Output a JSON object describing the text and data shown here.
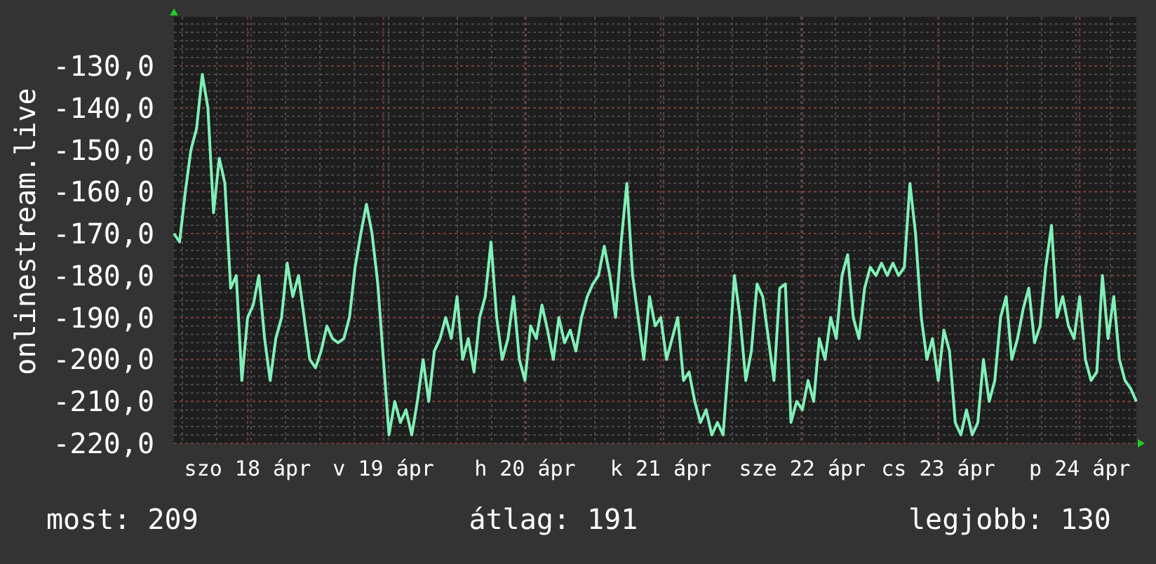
{
  "chart": {
    "chart_data": {
      "type": "line",
      "ylabel": "onlinestream.live",
      "ylim": [
        -220,
        -118.3
      ],
      "grid": true,
      "categories": [
        null,
        null,
        null,
        null,
        null,
        null,
        null,
        null,
        null,
        null,
        null,
        null,
        null,
        "szo 18 ápr",
        null,
        null,
        null,
        null,
        null,
        null,
        null,
        null,
        null,
        null,
        null,
        null,
        null,
        null,
        null,
        null,
        null,
        null,
        null,
        null,
        null,
        null,
        null,
        "v 19 ápr",
        null,
        null,
        null,
        null,
        null,
        null,
        null,
        null,
        null,
        null,
        null,
        null,
        null,
        null,
        null,
        null,
        null,
        null,
        null,
        null,
        null,
        null,
        null,
        null,
        "h 20 ápr",
        null,
        null,
        null,
        null,
        null,
        null,
        null,
        null,
        null,
        null,
        null,
        null,
        null,
        null,
        null,
        null,
        null,
        null,
        null,
        null,
        null,
        null,
        null,
        "k 21 ápr",
        null,
        null,
        null,
        null,
        null,
        null,
        null,
        null,
        null,
        null,
        null,
        null,
        null,
        null,
        null,
        null,
        null,
        null,
        null,
        null,
        null,
        null,
        null,
        null,
        "sze 22 ápr",
        null,
        null,
        null,
        null,
        null,
        null,
        null,
        null,
        null,
        null,
        null,
        null,
        null,
        null,
        null,
        null,
        null,
        null,
        null,
        null,
        null,
        null,
        null,
        "cs 23 ápr",
        null,
        null,
        null,
        null,
        null,
        null,
        null,
        null,
        null,
        null,
        null,
        null,
        null,
        null,
        null,
        null,
        null,
        null,
        null,
        null,
        null,
        null,
        null,
        null,
        "p 24 ápr",
        null,
        null,
        null,
        null,
        null,
        null,
        null,
        null,
        null,
        null
      ],
      "yticks": [
        {
          "value": -220,
          "label": "-220,0"
        },
        {
          "value": -210,
          "label": "-210,0"
        },
        {
          "value": -200,
          "label": "-200,0"
        },
        {
          "value": -190,
          "label": "-190,0"
        },
        {
          "value": -180,
          "label": "-180,0"
        },
        {
          "value": -170,
          "label": "-170,0"
        },
        {
          "value": -160,
          "label": "-160,0"
        },
        {
          "value": -150,
          "label": "-150,0"
        },
        {
          "value": -140,
          "label": "-140,0"
        },
        {
          "value": -130,
          "label": "-130,0"
        }
      ],
      "series": [
        {
          "color": "#80f0b8",
          "values": [
            -170,
            -172,
            -160,
            -150,
            -145,
            -132,
            -140,
            -165,
            -152,
            -158,
            -183,
            -180,
            -205,
            -190,
            -187,
            -180,
            -195,
            -205,
            -195,
            -190,
            -177,
            -185,
            -180,
            -190,
            -200,
            -202,
            -198,
            -192,
            -195,
            -196,
            -195,
            -190,
            -178,
            -170,
            -163,
            -170,
            -182,
            -200,
            -218,
            -210,
            -215,
            -212,
            -218,
            -210,
            -200,
            -210,
            -198,
            -195,
            -190,
            -195,
            -185,
            -200,
            -195,
            -203,
            -190,
            -185,
            -172,
            -190,
            -200,
            -195,
            -185,
            -200,
            -205,
            -192,
            -195,
            -187,
            -193,
            -200,
            -190,
            -196,
            -193,
            -198,
            -190,
            -185,
            -182,
            -180,
            -173,
            -180,
            -190,
            -172,
            -158,
            -180,
            -190,
            -200,
            -185,
            -192,
            -190,
            -200,
            -195,
            -190,
            -205,
            -203,
            -210,
            -215,
            -212,
            -218,
            -215,
            -218,
            -200,
            -180,
            -190,
            -205,
            -198,
            -182,
            -185,
            -195,
            -205,
            -183,
            -182,
            -215,
            -210,
            -212,
            -205,
            -210,
            -195,
            -200,
            -190,
            -195,
            -180,
            -175,
            -190,
            -195,
            -183,
            -178,
            -180,
            -177,
            -180,
            -177,
            -180,
            -178,
            -158,
            -170,
            -190,
            -200,
            -195,
            -205,
            -193,
            -198,
            -215,
            -218,
            -212,
            -218,
            -215,
            -200,
            -210,
            -205,
            -190,
            -185,
            -200,
            -195,
            -188,
            -183,
            -196,
            -192,
            -178,
            -168,
            -190,
            -185,
            -192,
            -195,
            -185,
            -200,
            -205,
            -203,
            -180,
            -195,
            -185,
            -200,
            -205,
            -207,
            -210
          ]
        }
      ]
    }
  },
  "stats": [
    "most: 209",
    "átlag: 191",
    "legjobb: 130"
  ]
}
